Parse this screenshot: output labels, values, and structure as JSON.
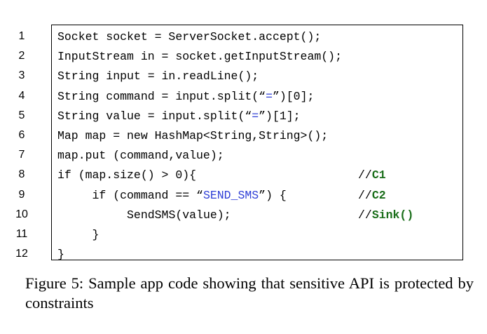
{
  "code_listing": {
    "lines": [
      {
        "number": "1",
        "indent": "",
        "segments": [
          {
            "text": "Socket socket = ServerSocket.accept();",
            "style": "plain"
          }
        ],
        "comment_prefix": "",
        "comment_label": ""
      },
      {
        "number": "2",
        "indent": "",
        "segments": [
          {
            "text": "InputStream in = socket.getInputStream();",
            "style": "plain"
          }
        ],
        "comment_prefix": "",
        "comment_label": ""
      },
      {
        "number": "3",
        "indent": "",
        "segments": [
          {
            "text": "String input = in.readLine();",
            "style": "plain"
          }
        ],
        "comment_prefix": "",
        "comment_label": ""
      },
      {
        "number": "4",
        "indent": "",
        "segments": [
          {
            "text": "String command = input.split(“",
            "style": "plain"
          },
          {
            "text": "=",
            "style": "string"
          },
          {
            "text": "”)[0];",
            "style": "plain"
          }
        ],
        "comment_prefix": "",
        "comment_label": ""
      },
      {
        "number": "5",
        "indent": "",
        "segments": [
          {
            "text": "String value = input.split(“",
            "style": "plain"
          },
          {
            "text": "=",
            "style": "string"
          },
          {
            "text": "”)[1];",
            "style": "plain"
          }
        ],
        "comment_prefix": "",
        "comment_label": ""
      },
      {
        "number": "6",
        "indent": "",
        "segments": [
          {
            "text": "Map map = new HashMap<String,String>();",
            "style": "plain"
          }
        ],
        "comment_prefix": "",
        "comment_label": ""
      },
      {
        "number": "7",
        "indent": "",
        "segments": [
          {
            "text": "map.put (command,value);",
            "style": "plain"
          }
        ],
        "comment_prefix": "",
        "comment_label": ""
      },
      {
        "number": "8",
        "indent": "",
        "segments": [
          {
            "text": "if (map.size() > 0){",
            "style": "plain"
          }
        ],
        "comment_prefix": "//",
        "comment_label": "C1"
      },
      {
        "number": "9",
        "indent": "     ",
        "segments": [
          {
            "text": "if (command == “",
            "style": "plain"
          },
          {
            "text": "SEND_SMS",
            "style": "string"
          },
          {
            "text": "”) {",
            "style": "plain"
          }
        ],
        "comment_prefix": "//",
        "comment_label": "C2"
      },
      {
        "number": "10",
        "indent": "          ",
        "segments": [
          {
            "text": "SendSMS(value);",
            "style": "plain"
          }
        ],
        "comment_prefix": "//",
        "comment_label": "Sink()"
      },
      {
        "number": "11",
        "indent": "     ",
        "segments": [
          {
            "text": "}",
            "style": "plain"
          }
        ],
        "comment_prefix": "",
        "comment_label": ""
      },
      {
        "number": "12",
        "indent": "",
        "segments": [
          {
            "text": "}",
            "style": "plain"
          }
        ],
        "comment_prefix": "",
        "comment_label": ""
      }
    ]
  },
  "caption": {
    "text": "Figure 5: Sample app code showing that sensitive API is protected by constraints"
  },
  "colors": {
    "string": "#2f3fd6",
    "comment_label": "#1a6e1a"
  }
}
